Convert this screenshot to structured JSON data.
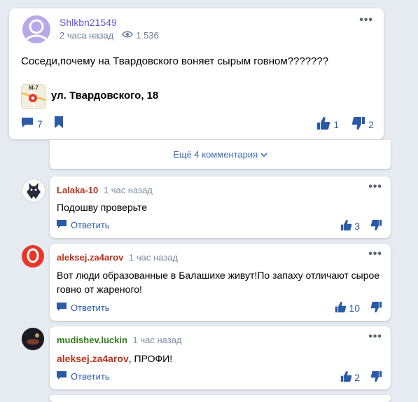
{
  "post": {
    "author": "Shlkbn21549",
    "time": "2 часа назад",
    "views": "1 536",
    "text": "Соседи,почему на Твардовского воняет сырым говном???????",
    "map_label": "М-7",
    "address": "ул. Твардовского, 18",
    "comments_count": "7",
    "likes": "1",
    "dislikes": "2",
    "icons": {
      "views": "eye-icon",
      "comments": "comment-icon",
      "bookmark": "bookmark-icon",
      "like": "thumbs-up-icon",
      "dislike": "thumbs-down-icon",
      "menu": "more-dots-icon"
    }
  },
  "more_comments": "Ещё 4 комментария",
  "comments": [
    {
      "author": "Lalaka-10",
      "author_color": "#b8321e",
      "time": "1 час назад",
      "text": "Подошву проверьте",
      "reply_label": "Ответить",
      "likes": "3"
    },
    {
      "author": "aleksej.za4arov",
      "author_color": "#b8321e",
      "time": "1 час назад",
      "text": "Вот люди образованные в Балашихе живут!По запаху отличают сырое говно от жареного!",
      "reply_label": "Ответить",
      "likes": "10"
    },
    {
      "author": "mudishev.luckin",
      "author_color": "#2f7d1a",
      "time": "1 час назад",
      "mention": "aleksej.za4arov",
      "text": ", ПРОФИ!",
      "reply_label": "Ответить",
      "likes": "2"
    }
  ],
  "colors": {
    "accent": "#2b5aa8",
    "author_post": "#6a55d9",
    "background": "#e6ebf1"
  }
}
